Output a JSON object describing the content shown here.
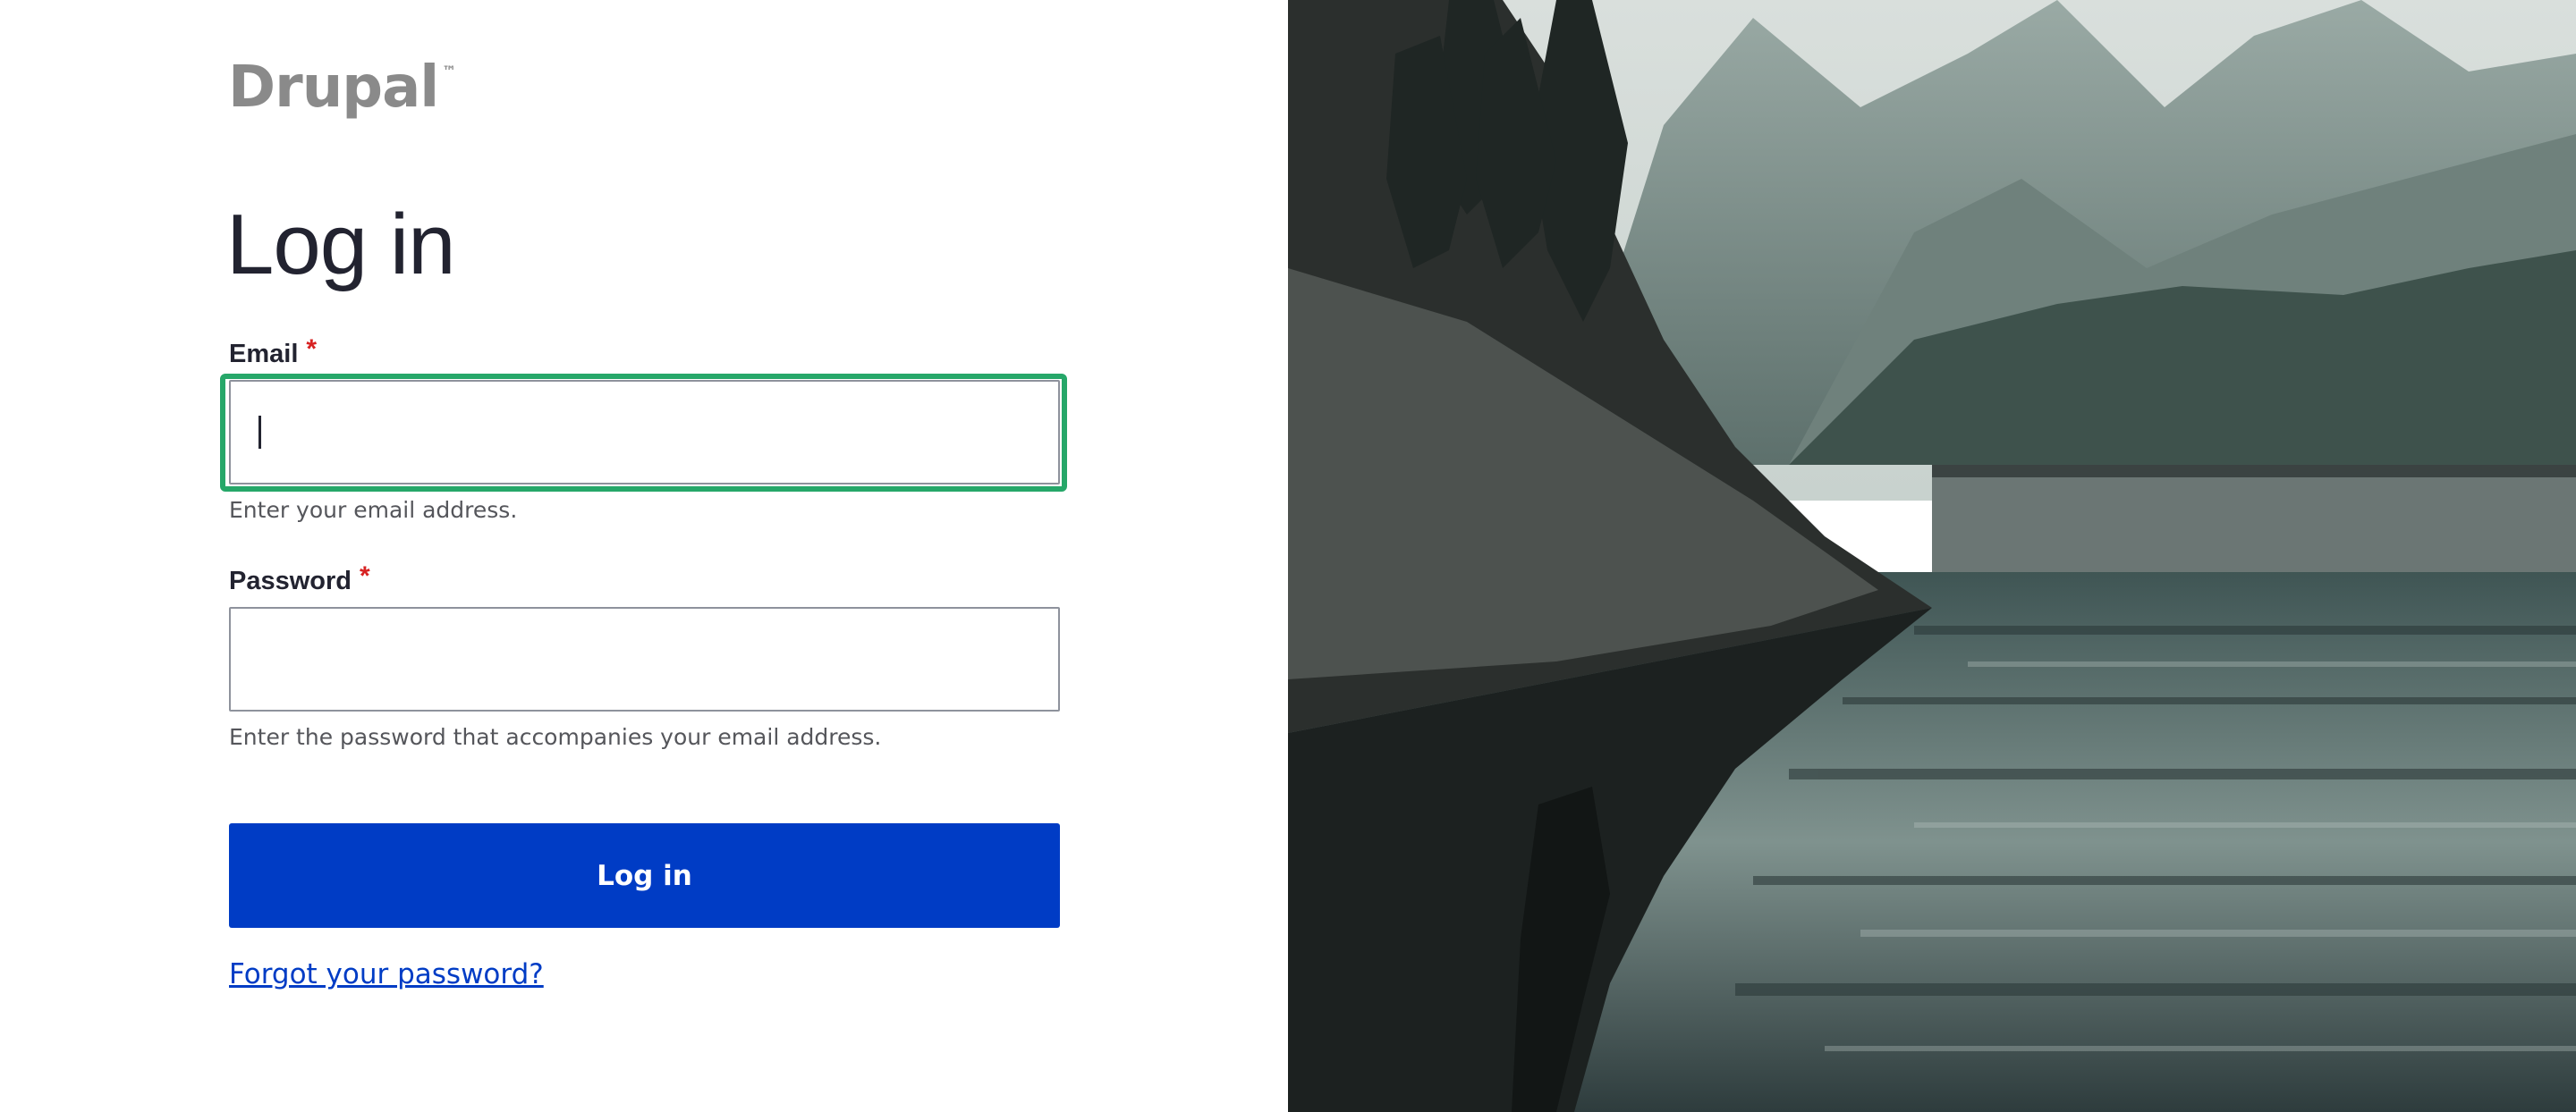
{
  "brand": {
    "logo_text": "Drupal",
    "trademark": "™"
  },
  "page": {
    "title": "Log in"
  },
  "form": {
    "email": {
      "label": "Email",
      "required_marker": "*",
      "value": "",
      "help": "Enter your email address."
    },
    "password": {
      "label": "Password",
      "required_marker": "*",
      "value": "",
      "help": "Enter the password that accompanies your email address."
    },
    "submit_label": "Log in",
    "forgot_link": "Forgot your password?"
  },
  "colors": {
    "accent": "#003cc5",
    "focus_ring": "#26a769",
    "required": "#d72222",
    "logo_gray": "#8a8a8a"
  },
  "icons": {
    "background": "mountain-lake-photo"
  }
}
